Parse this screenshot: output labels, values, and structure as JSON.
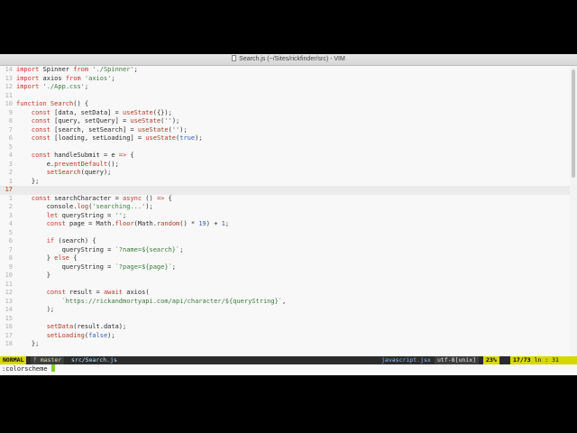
{
  "window": {
    "title": "Search.js (~/Sites/rickfinder/src) - VIM"
  },
  "lines": [
    {
      "n": "14",
      "current": false,
      "t": [
        [
          "k",
          "import"
        ],
        [
          "txt",
          " Spinner "
        ],
        [
          "k",
          "from"
        ],
        [
          "s",
          " './Spinner'"
        ],
        [
          "txt",
          ";"
        ]
      ]
    },
    {
      "n": "13",
      "current": false,
      "t": [
        [
          "k",
          "import"
        ],
        [
          "txt",
          " axios "
        ],
        [
          "k",
          "from"
        ],
        [
          "s",
          " 'axios'"
        ],
        [
          "txt",
          ";"
        ]
      ]
    },
    {
      "n": "12",
      "current": false,
      "t": [
        [
          "k",
          "import"
        ],
        [
          "s",
          " './App.css'"
        ],
        [
          "txt",
          ";"
        ]
      ]
    },
    {
      "n": "11",
      "current": false,
      "t": [
        [
          "txt",
          ""
        ]
      ]
    },
    {
      "n": "10",
      "current": false,
      "t": [
        [
          "k",
          "function"
        ],
        [
          "f",
          " Search"
        ],
        [
          "txt",
          "() {"
        ]
      ]
    },
    {
      "n": "9",
      "current": false,
      "t": [
        [
          "txt",
          "    "
        ],
        [
          "k",
          "const"
        ],
        [
          "txt",
          " [data, setData] = "
        ],
        [
          "f",
          "useState"
        ],
        [
          "txt",
          "({});"
        ]
      ]
    },
    {
      "n": "8",
      "current": false,
      "t": [
        [
          "txt",
          "    "
        ],
        [
          "k",
          "const"
        ],
        [
          "txt",
          " [query, setQuery] = "
        ],
        [
          "f",
          "useState"
        ],
        [
          "txt",
          "("
        ],
        [
          "s",
          "''"
        ],
        [
          "txt",
          ");"
        ]
      ]
    },
    {
      "n": "7",
      "current": false,
      "t": [
        [
          "txt",
          "    "
        ],
        [
          "k",
          "const"
        ],
        [
          "txt",
          " [search, setSearch] = "
        ],
        [
          "f",
          "useState"
        ],
        [
          "txt",
          "("
        ],
        [
          "s",
          "''"
        ],
        [
          "txt",
          ");"
        ]
      ]
    },
    {
      "n": "6",
      "current": false,
      "t": [
        [
          "txt",
          "    "
        ],
        [
          "k",
          "const"
        ],
        [
          "txt",
          " [loading, setLoading] = "
        ],
        [
          "f",
          "useState"
        ],
        [
          "txt",
          "("
        ],
        [
          "n",
          "true"
        ],
        [
          "txt",
          ");"
        ]
      ]
    },
    {
      "n": "5",
      "current": false,
      "t": [
        [
          "txt",
          ""
        ]
      ]
    },
    {
      "n": "4",
      "current": false,
      "t": [
        [
          "txt",
          "    "
        ],
        [
          "k",
          "const"
        ],
        [
          "txt",
          " handleSubmit = e "
        ],
        [
          "k",
          "=>"
        ],
        [
          "txt",
          " {"
        ]
      ]
    },
    {
      "n": "3",
      "current": false,
      "t": [
        [
          "txt",
          "        e."
        ],
        [
          "f",
          "preventDefault"
        ],
        [
          "txt",
          "();"
        ]
      ]
    },
    {
      "n": "2",
      "current": false,
      "t": [
        [
          "txt",
          "        "
        ],
        [
          "f",
          "setSearch"
        ],
        [
          "txt",
          "(query);"
        ]
      ]
    },
    {
      "n": "1",
      "current": false,
      "t": [
        [
          "txt",
          "    };"
        ]
      ]
    },
    {
      "n": "17",
      "current": true,
      "t": [
        [
          "txt",
          ""
        ]
      ]
    },
    {
      "n": "1",
      "current": false,
      "t": [
        [
          "txt",
          "    "
        ],
        [
          "k",
          "const"
        ],
        [
          "txt",
          " searchCharacter = "
        ],
        [
          "k",
          "async"
        ],
        [
          "txt",
          " () "
        ],
        [
          "k",
          "=>"
        ],
        [
          "txt",
          " {"
        ]
      ]
    },
    {
      "n": "2",
      "current": false,
      "t": [
        [
          "txt",
          "        console."
        ],
        [
          "f",
          "log"
        ],
        [
          "txt",
          "("
        ],
        [
          "s",
          "'searching...'"
        ],
        [
          "txt",
          ");"
        ]
      ]
    },
    {
      "n": "3",
      "current": false,
      "t": [
        [
          "txt",
          "        "
        ],
        [
          "k",
          "let"
        ],
        [
          "txt",
          " queryString = "
        ],
        [
          "s",
          "''"
        ],
        [
          "txt",
          ";"
        ]
      ]
    },
    {
      "n": "4",
      "current": false,
      "t": [
        [
          "txt",
          "        "
        ],
        [
          "k",
          "const"
        ],
        [
          "txt",
          " page = Math."
        ],
        [
          "f",
          "floor"
        ],
        [
          "txt",
          "(Math."
        ],
        [
          "f",
          "random"
        ],
        [
          "txt",
          "() * "
        ],
        [
          "n",
          "19"
        ],
        [
          "txt",
          ") + "
        ],
        [
          "n",
          "1"
        ],
        [
          "txt",
          ";"
        ]
      ]
    },
    {
      "n": "5",
      "current": false,
      "t": [
        [
          "txt",
          ""
        ]
      ]
    },
    {
      "n": "6",
      "current": false,
      "t": [
        [
          "txt",
          "        "
        ],
        [
          "k",
          "if"
        ],
        [
          "txt",
          " (search) {"
        ]
      ]
    },
    {
      "n": "7",
      "current": false,
      "t": [
        [
          "txt",
          "            queryString = "
        ],
        [
          "s",
          "`?name=${search}`"
        ],
        [
          "txt",
          ";"
        ]
      ]
    },
    {
      "n": "8",
      "current": false,
      "t": [
        [
          "txt",
          "        } "
        ],
        [
          "k",
          "else"
        ],
        [
          "txt",
          " {"
        ]
      ]
    },
    {
      "n": "9",
      "current": false,
      "t": [
        [
          "txt",
          "            queryString = "
        ],
        [
          "s",
          "`?page=${page}`"
        ],
        [
          "txt",
          ";"
        ]
      ]
    },
    {
      "n": "10",
      "current": false,
      "t": [
        [
          "txt",
          "        }"
        ]
      ]
    },
    {
      "n": "11",
      "current": false,
      "t": [
        [
          "txt",
          ""
        ]
      ]
    },
    {
      "n": "12",
      "current": false,
      "t": [
        [
          "txt",
          "        "
        ],
        [
          "k",
          "const"
        ],
        [
          "txt",
          " result = "
        ],
        [
          "k",
          "await"
        ],
        [
          "txt",
          " axios("
        ]
      ]
    },
    {
      "n": "13",
      "current": false,
      "t": [
        [
          "txt",
          "            "
        ],
        [
          "s",
          "`https://rickandmortyapi.com/api/character/${queryString}`"
        ],
        [
          "txt",
          ","
        ]
      ]
    },
    {
      "n": "14",
      "current": false,
      "t": [
        [
          "txt",
          "        );"
        ]
      ]
    },
    {
      "n": "15",
      "current": false,
      "t": [
        [
          "txt",
          ""
        ]
      ]
    },
    {
      "n": "16",
      "current": false,
      "t": [
        [
          "txt",
          "        "
        ],
        [
          "f",
          "setData"
        ],
        [
          "txt",
          "(result.data);"
        ]
      ]
    },
    {
      "n": "17",
      "current": false,
      "t": [
        [
          "txt",
          "        "
        ],
        [
          "f",
          "setLoading"
        ],
        [
          "txt",
          "("
        ],
        [
          "n",
          "false"
        ],
        [
          "txt",
          ");"
        ]
      ]
    },
    {
      "n": "18",
      "current": false,
      "t": [
        [
          "txt",
          "    };"
        ]
      ]
    }
  ],
  "statusline": {
    "mode": "NORMAL",
    "branch": "ᚠ master",
    "file": "src/Search.js",
    "filetype": "javascript.jsx",
    "encoding": "utf-8[unix]",
    "percent": "23%",
    "position_line": "17/73",
    "position_col": "ln : 31"
  },
  "cmdline": {
    "text": ":colorscheme "
  },
  "colors": {
    "keyword": "#c8342b",
    "string": "#3c7a3c",
    "function": "#b2381f",
    "number": "#2f5fb0",
    "mode_bg": "#d7d700",
    "cursor": "#7ecf2e"
  }
}
